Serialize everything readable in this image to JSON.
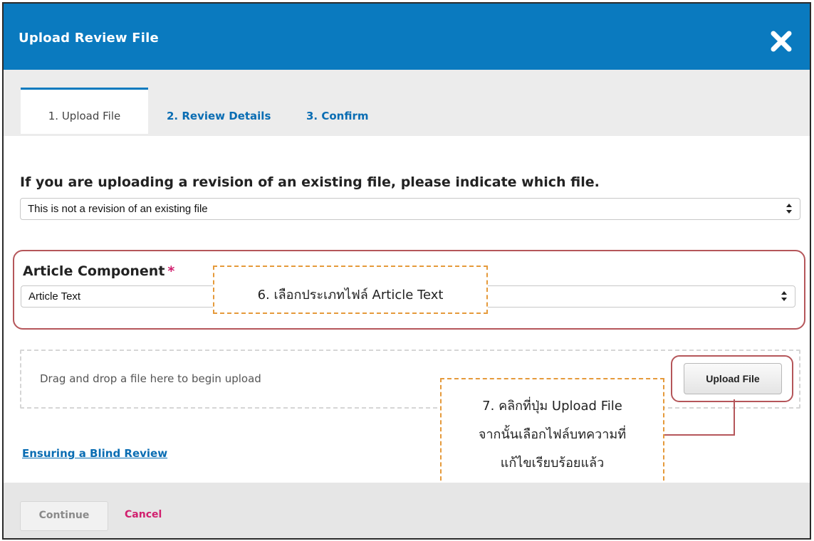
{
  "header": {
    "title": "Upload Review File",
    "close_icon": "close-x-icon"
  },
  "tabs": [
    {
      "label": "1. Upload File",
      "active": true
    },
    {
      "label": "2. Review Details",
      "active": false
    },
    {
      "label": "3. Confirm",
      "active": false
    }
  ],
  "revision": {
    "label": "If you are uploading a revision of an existing file, please indicate which file.",
    "selected": "This is not a revision of an existing file"
  },
  "component": {
    "label": "Article Component",
    "required_mark": "*",
    "selected": "Article Text"
  },
  "dropzone": {
    "text": "Drag and drop a file here to begin upload",
    "upload_button": "Upload File"
  },
  "links": {
    "blind_review": "Ensuring a Blind Review"
  },
  "footer": {
    "continue": "Continue",
    "cancel": "Cancel"
  },
  "annotations": {
    "step6": "6. เลือกประเภทไฟล์ Article Text",
    "step7_lines": [
      "7. คลิกที่ปุ่ม Upload File",
      "จากนั้นเลือกไฟล์บทความที่",
      "แก้ไขเรียบร้อยแล้ว"
    ]
  },
  "colors": {
    "header_blue": "#0a7abf",
    "link_blue": "#0a6db3",
    "cancel_pink": "#d11f6e",
    "highlight_red": "#b5565a",
    "annotation_orange": "#e59a3b"
  }
}
